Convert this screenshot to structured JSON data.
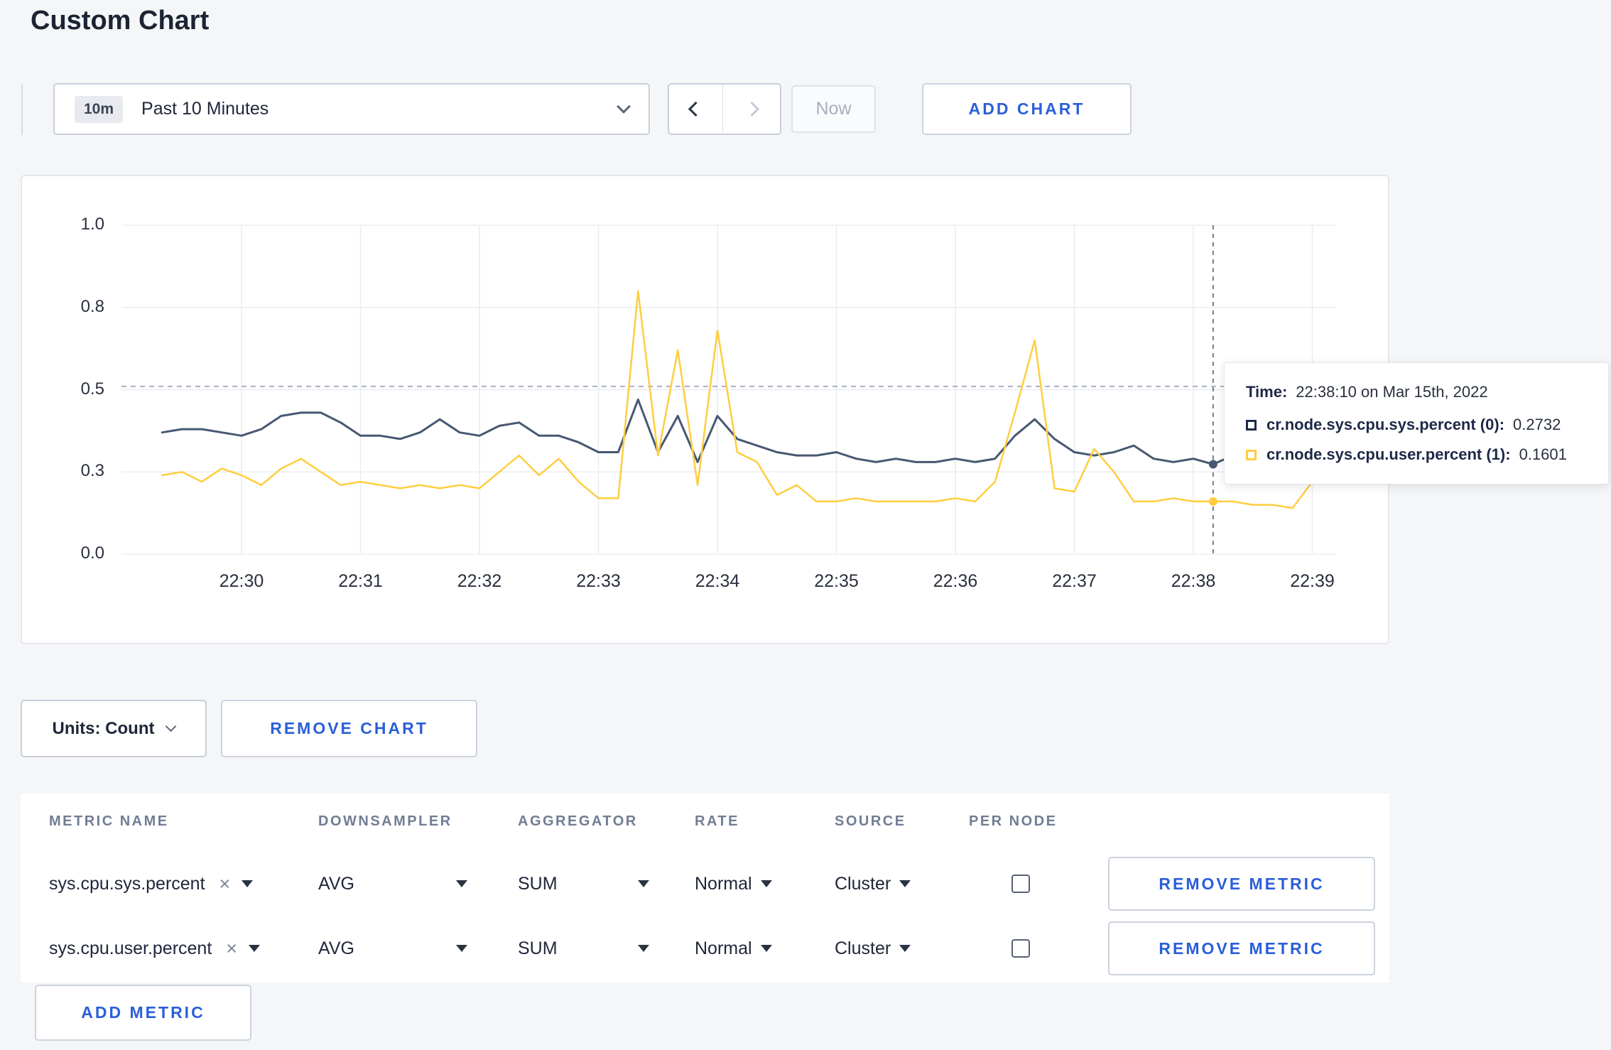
{
  "page": {
    "title": "Custom Chart"
  },
  "toolbar": {
    "range_badge": "10m",
    "range_label": "Past 10 Minutes",
    "now_label": "Now",
    "add_chart_label": "ADD CHART"
  },
  "chart": {
    "tooltip": {
      "time_label": "Time:",
      "time_value": "22:38:10 on Mar 15th, 2022",
      "rows": [
        {
          "label": "cr.node.sys.cpu.sys.percent (0):",
          "value": "0.2732",
          "color": "#1d2946"
        },
        {
          "label": "cr.node.sys.cpu.user.percent (1):",
          "value": "0.1601",
          "color": "#ffcd3f"
        }
      ]
    }
  },
  "chart_data": {
    "type": "line",
    "title": "",
    "xlabel": "",
    "ylabel": "",
    "ylim": [
      0,
      1
    ],
    "grid": true,
    "x_ticks": [
      "22:30",
      "22:31",
      "22:32",
      "22:33",
      "22:34",
      "22:35",
      "22:36",
      "22:37",
      "22:38",
      "22:39"
    ],
    "y_tick_values": [
      0,
      0.25,
      0.5,
      0.75,
      1.0
    ],
    "y_tick_labels": [
      "0.0",
      "0.3",
      "0.5",
      "0.8",
      "1.0"
    ],
    "x_start": "22:29:20",
    "x_interval_sec": 10,
    "threshold_value": 0.51,
    "crosshair_time": "22:38:10",
    "series": [
      {
        "name": "cr.node.sys.cpu.sys.percent",
        "color": "#475872",
        "hover_value": 0.2732,
        "values": [
          0.37,
          0.38,
          0.38,
          0.37,
          0.36,
          0.38,
          0.42,
          0.43,
          0.43,
          0.4,
          0.36,
          0.36,
          0.35,
          0.37,
          0.41,
          0.37,
          0.36,
          0.39,
          0.4,
          0.36,
          0.36,
          0.34,
          0.31,
          0.31,
          0.47,
          0.31,
          0.42,
          0.28,
          0.42,
          0.35,
          0.33,
          0.31,
          0.3,
          0.3,
          0.31,
          0.29,
          0.28,
          0.29,
          0.28,
          0.28,
          0.29,
          0.28,
          0.29,
          0.36,
          0.41,
          0.35,
          0.31,
          0.3,
          0.31,
          0.33,
          0.29,
          0.28,
          0.29,
          0.2732,
          0.3,
          0.31,
          0.3,
          0.3,
          0.31,
          0.3
        ]
      },
      {
        "name": "cr.node.sys.cpu.user.percent",
        "color": "#ffcd3f",
        "hover_value": 0.1601,
        "values": [
          0.24,
          0.25,
          0.22,
          0.26,
          0.24,
          0.21,
          0.26,
          0.29,
          0.25,
          0.21,
          0.22,
          0.21,
          0.2,
          0.21,
          0.2,
          0.21,
          0.2,
          0.25,
          0.3,
          0.24,
          0.29,
          0.22,
          0.17,
          0.17,
          0.8,
          0.3,
          0.62,
          0.21,
          0.68,
          0.31,
          0.28,
          0.18,
          0.21,
          0.16,
          0.16,
          0.17,
          0.16,
          0.16,
          0.16,
          0.16,
          0.17,
          0.16,
          0.22,
          0.43,
          0.65,
          0.2,
          0.19,
          0.32,
          0.25,
          0.16,
          0.16,
          0.17,
          0.16,
          0.1601,
          0.16,
          0.15,
          0.15,
          0.14,
          0.22,
          0.27
        ]
      }
    ]
  },
  "controls": {
    "units_label": "Units: Count",
    "remove_chart_label": "REMOVE CHART",
    "add_metric_label": "ADD METRIC"
  },
  "table": {
    "headers": [
      "METRIC NAME",
      "DOWNSAMPLER",
      "AGGREGATOR",
      "RATE",
      "SOURCE",
      "PER NODE"
    ],
    "rows": [
      {
        "metric": "sys.cpu.sys.percent",
        "downsampler": "AVG",
        "aggregator": "SUM",
        "rate": "Normal",
        "source": "Cluster",
        "per_node": false,
        "remove_label": "REMOVE METRIC"
      },
      {
        "metric": "sys.cpu.user.percent",
        "downsampler": "AVG",
        "aggregator": "SUM",
        "rate": "Normal",
        "source": "Cluster",
        "per_node": false,
        "remove_label": "REMOVE METRIC"
      }
    ]
  }
}
